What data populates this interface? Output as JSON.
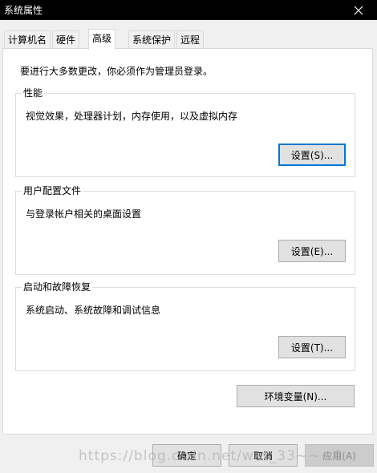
{
  "window": {
    "title": "系统属性"
  },
  "tabs": [
    {
      "label": "计算机名"
    },
    {
      "label": "硬件"
    },
    {
      "label": "高级"
    },
    {
      "label": "系统保护"
    },
    {
      "label": "远程"
    }
  ],
  "panel": {
    "intro": "要进行大多数更改，你必须作为管理员登录。",
    "performance": {
      "label": "性能",
      "desc": "视觉效果，处理器计划，内存使用，以及虚拟内存",
      "button": "设置(S)..."
    },
    "profiles": {
      "label": "用户配置文件",
      "desc": "与登录帐户相关的桌面设置",
      "button": "设置(E)..."
    },
    "startup": {
      "label": "启动和故障恢复",
      "desc": "系统启动、系统故障和调试信息",
      "button": "设置(T)..."
    },
    "env_button": "环境变量(N)..."
  },
  "footer": {
    "ok": "确定",
    "cancel": "取消",
    "apply": "应用(A)"
  },
  "watermark": "https://blog.csdn.net/wat_33~~~6",
  "colors": {
    "focus": "#0078d7",
    "titlebar": "#000000"
  }
}
